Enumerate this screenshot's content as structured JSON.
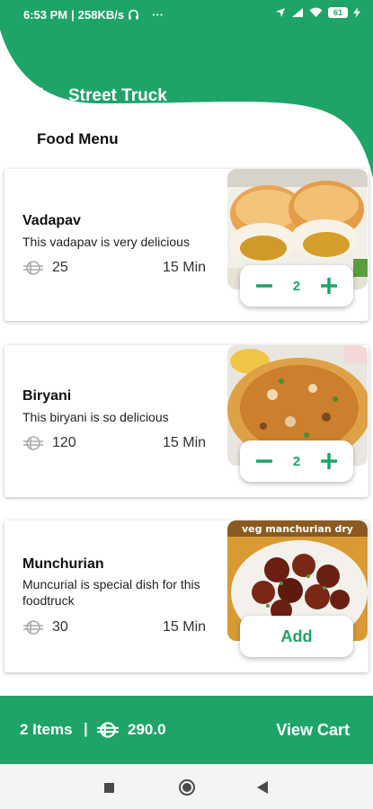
{
  "status_bar": {
    "time": "6:53 PM",
    "speed": "258KB/s",
    "more": "···",
    "battery": "61"
  },
  "header": {
    "title": "Street Truck",
    "back_icon": "arrow-left-icon"
  },
  "section_title": "Food Menu",
  "items": [
    {
      "name": "Vadapav",
      "description": "This vadapav is very delicious",
      "price": "25",
      "time": "15 Min",
      "quantity": "2",
      "has_stepper": true
    },
    {
      "name": "Biryani",
      "description": "This biryani is so delicious",
      "price": "120",
      "time": "15 Min",
      "quantity": "2",
      "has_stepper": true
    },
    {
      "name": "Munchurian",
      "description": "Muncurial is special dish for this foodtruck",
      "price": "30",
      "time": "15 Min",
      "add_label": "Add",
      "image_caption": "veg manchurian dry",
      "has_stepper": false
    }
  ],
  "cart": {
    "items_count": "2 Items",
    "separator": "|",
    "total": "290.0",
    "view_cart_label": "View Cart"
  },
  "colors": {
    "primary": "#1fa468",
    "text": "#111111"
  }
}
